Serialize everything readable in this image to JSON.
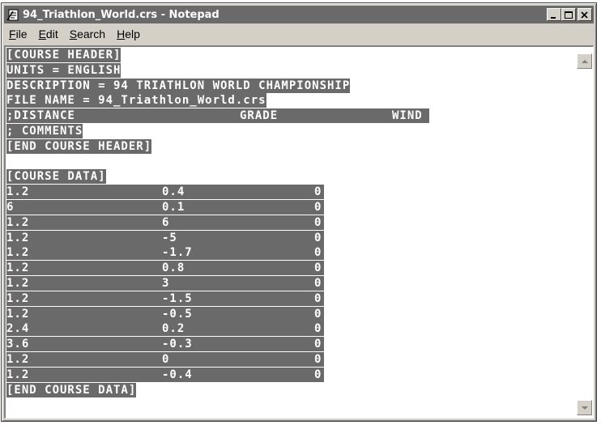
{
  "window": {
    "title": "94_Triathlon_World.crs - Notepad",
    "icon": "notepad-icon"
  },
  "menu": [
    {
      "label_prefix": "",
      "mnemonic": "F",
      "label_suffix": "ile"
    },
    {
      "label_prefix": "",
      "mnemonic": "E",
      "label_suffix": "dit"
    },
    {
      "label_prefix": "",
      "mnemonic": "S",
      "label_suffix": "earch"
    },
    {
      "label_prefix": "",
      "mnemonic": "H",
      "label_suffix": "elp"
    }
  ],
  "header_lines": [
    "[COURSE HEADER]",
    "UNITS = ENGLISH",
    "DESCRIPTION = 94 TRIATHLON WORLD CHAMPIONSHIP",
    "FILE NAME = 94_Triathlon_World.crs"
  ],
  "columns_line": {
    "distance": ";DISTANCE",
    "grade": "GRADE",
    "wind": "WIND"
  },
  "comments_line": "; COMMENTS",
  "end_header": "[END COURSE HEADER]",
  "data_start": "[COURSE DATA]",
  "rows": [
    {
      "distance": "1.2",
      "grade": "0.4",
      "wind": "0"
    },
    {
      "distance": "6",
      "grade": "0.1",
      "wind": "0"
    },
    {
      "distance": "1.2",
      "grade": "6",
      "wind": "0"
    },
    {
      "distance": "1.2",
      "grade": "-5",
      "wind": "0"
    },
    {
      "distance": "1.2",
      "grade": "-1.7",
      "wind": "0"
    },
    {
      "distance": "1.2",
      "grade": "0.8",
      "wind": "0"
    },
    {
      "distance": "1.2",
      "grade": "3",
      "wind": "0"
    },
    {
      "distance": "1.2",
      "grade": "-1.5",
      "wind": "0"
    },
    {
      "distance": "1.2",
      "grade": "-0.5",
      "wind": "0"
    },
    {
      "distance": "2.4",
      "grade": "0.2",
      "wind": "0"
    },
    {
      "distance": "3.6",
      "grade": "-0.3",
      "wind": "0"
    },
    {
      "distance": "1.2",
      "grade": "0",
      "wind": "0"
    },
    {
      "distance": "1.2",
      "grade": "-0.4",
      "wind": "0"
    }
  ],
  "data_end": "[END COURSE DATA]",
  "colors": {
    "selection": "#6a6a6a",
    "face": "#d4d0c8"
  }
}
